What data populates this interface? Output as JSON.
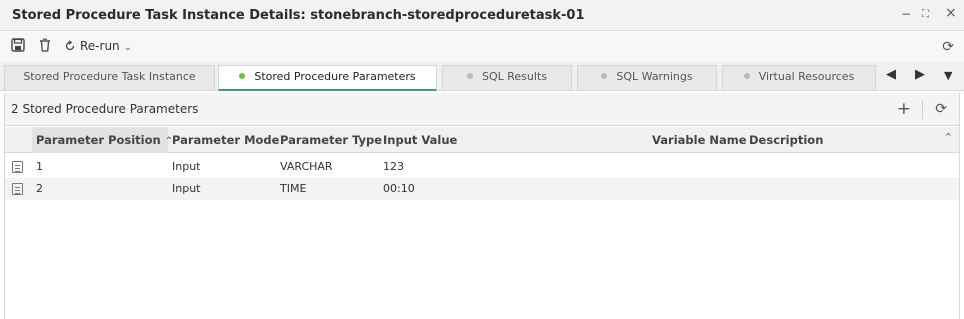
{
  "window": {
    "title": "Stored Procedure Task Instance Details: stonebranch-storedproceduretask-01",
    "minimize_glyph": "−",
    "restore_glyph": "⛶",
    "close_glyph": "×"
  },
  "toolbar": {
    "save_icon": "save-icon",
    "delete_icon": "trash-icon",
    "rerun_label": "Re-run",
    "rerun_chevron": "⌄",
    "refresh_glyph": "⟳"
  },
  "tabs": [
    {
      "label": "Stored Procedure Task Instance",
      "active": false
    },
    {
      "label": "Stored Procedure Parameters",
      "active": true
    },
    {
      "label": "SQL Results",
      "active": false
    },
    {
      "label": "SQL Warnings",
      "active": false
    },
    {
      "label": "Virtual Resources",
      "active": false
    }
  ],
  "tab_nav": {
    "prev": "◀",
    "next": "▶",
    "more": "▼"
  },
  "panel": {
    "title": "2 Stored Procedure Parameters",
    "add_glyph": "+",
    "refresh_glyph": "⟳"
  },
  "grid": {
    "columns": [
      "Parameter Position",
      "Parameter Mode",
      "Parameter Type",
      "Input Value",
      "Variable Name",
      "Description"
    ],
    "sort_glyph": "⌃",
    "collapse_glyph": "⌃",
    "rows": [
      {
        "position": "1",
        "mode": "Input",
        "type": "VARCHAR",
        "input_value": "123",
        "variable_name": "",
        "description": ""
      },
      {
        "position": "2",
        "mode": "Input",
        "type": "TIME",
        "input_value": "00:10",
        "variable_name": "",
        "description": ""
      }
    ]
  },
  "colors": {
    "active_tab_underline": "#3c9a8b",
    "active_dot": "#6cbf3f",
    "inactive_dot": "#bbbbbb"
  }
}
